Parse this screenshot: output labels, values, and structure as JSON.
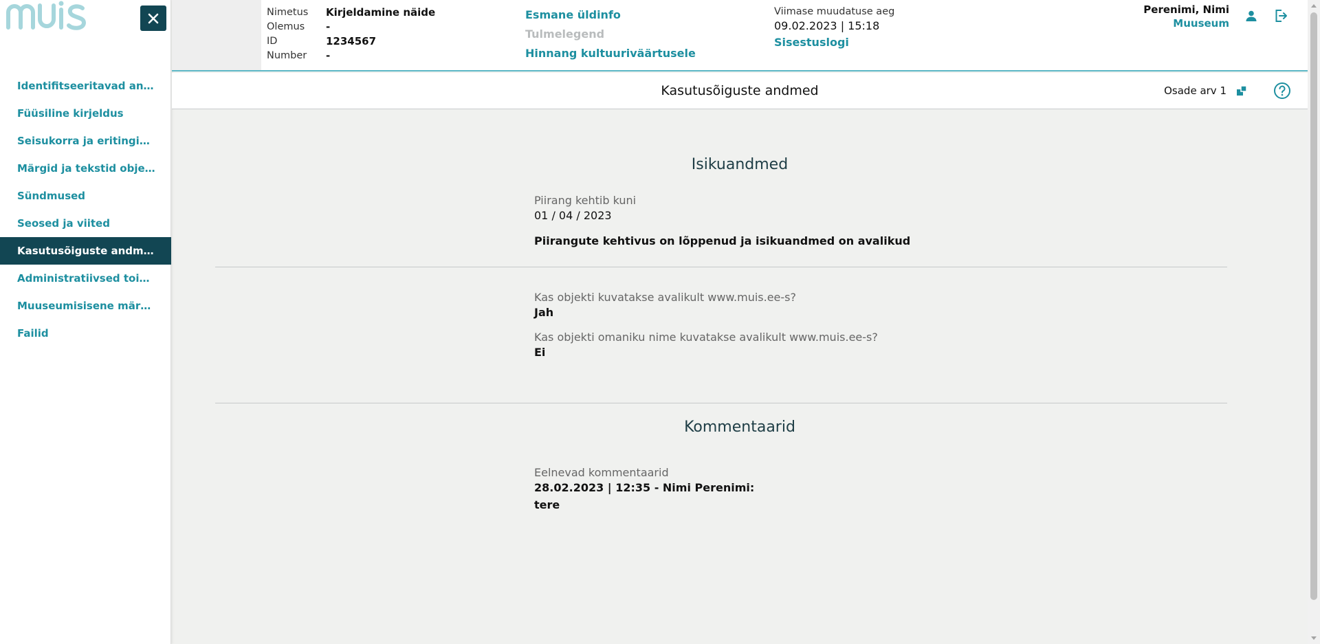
{
  "app": {
    "logo_text": "muis"
  },
  "sidebar": {
    "items": [
      {
        "label": "Identifitseeritavad andmed",
        "active": false
      },
      {
        "label": "Füüsiline kirjeldus",
        "active": false
      },
      {
        "label": "Seisukorra ja eritingimuste andmed",
        "active": false
      },
      {
        "label": "Märgid ja tekstid objektil",
        "active": false
      },
      {
        "label": "Sündmused",
        "active": false
      },
      {
        "label": "Seosed ja viited",
        "active": false
      },
      {
        "label": "Kasutusõiguste andmed",
        "active": true
      },
      {
        "label": "Administratiivsed toimingud",
        "active": false
      },
      {
        "label": "Muuseumisisene märkus",
        "active": false
      },
      {
        "label": "Failid",
        "active": false
      }
    ]
  },
  "header": {
    "meta": [
      {
        "label": "Nimetus",
        "value": "Kirjeldamine näide"
      },
      {
        "label": "Olemus",
        "value": "-"
      },
      {
        "label": "ID",
        "value": "1234567"
      },
      {
        "label": "Number",
        "value": "-"
      }
    ],
    "links": {
      "general_info": "Esmane üldinfo",
      "legend": "Tulmelegend",
      "valuation": "Hinnang kultuuriväärtusele"
    },
    "modification": {
      "label": "Viimase muudatuse aeg",
      "value": "09.02.2023 | 15:18",
      "log_link": "Sisestuslogi"
    },
    "user": {
      "name": "Perenimi, Nimi",
      "museum": "Muuseum"
    }
  },
  "titlebar": {
    "title": "Kasutusõiguste andmed",
    "parts_label": "Osade arv 1"
  },
  "content": {
    "personal": {
      "title": "Isikuandmed",
      "restriction_label": "Piirang kehtib kuni",
      "restriction_value": "01 / 04 / 2023",
      "statement": "Piirangute kehtivus on lõppenud ja isikuandmed on avalikud"
    },
    "visibility": {
      "q1_label": "Kas objekti kuvatakse avalikult www.muis.ee-s?",
      "q1_value": "Jah",
      "q2_label": "Kas objekti omaniku nime kuvatakse avalikult www.muis.ee-s?",
      "q2_value": "Ei"
    },
    "comments": {
      "title": "Kommentaarid",
      "label": "Eelnevad kommentaarid",
      "entry_header": "28.02.2023 | 12:35 - Nimi Perenimi:",
      "entry_text": "tere"
    }
  },
  "colors": {
    "accent": "#1d8fa0",
    "dark": "#124653",
    "header_border": "#5db8c6",
    "content_bg": "#f0f1ef"
  },
  "icons": [
    "close-icon",
    "user-icon",
    "logout-icon",
    "parts-icon",
    "help-icon"
  ]
}
